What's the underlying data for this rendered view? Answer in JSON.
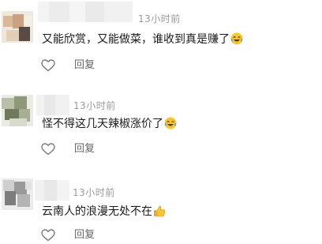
{
  "comments": [
    {
      "time": "13小时前",
      "text": "又能欣赏，又能做菜，谁收到真是赚了",
      "emoji": "laughing-tears-emoji",
      "reply_label": "回复"
    },
    {
      "time": "13小时前",
      "text": "怪不得这几天辣椒涨价了",
      "emoji": "laughing-tears-emoji",
      "reply_label": "回复"
    },
    {
      "time": "13小时前",
      "text": "云南人的浪漫无处不在",
      "emoji": "thumbs-up-emoji",
      "reply_label": "回复"
    }
  ],
  "icons": {
    "like": "heart-outline-icon"
  },
  "colors": {
    "text": "#1a1a1a",
    "meta": "#9a9a9a",
    "reply": "#666666"
  }
}
